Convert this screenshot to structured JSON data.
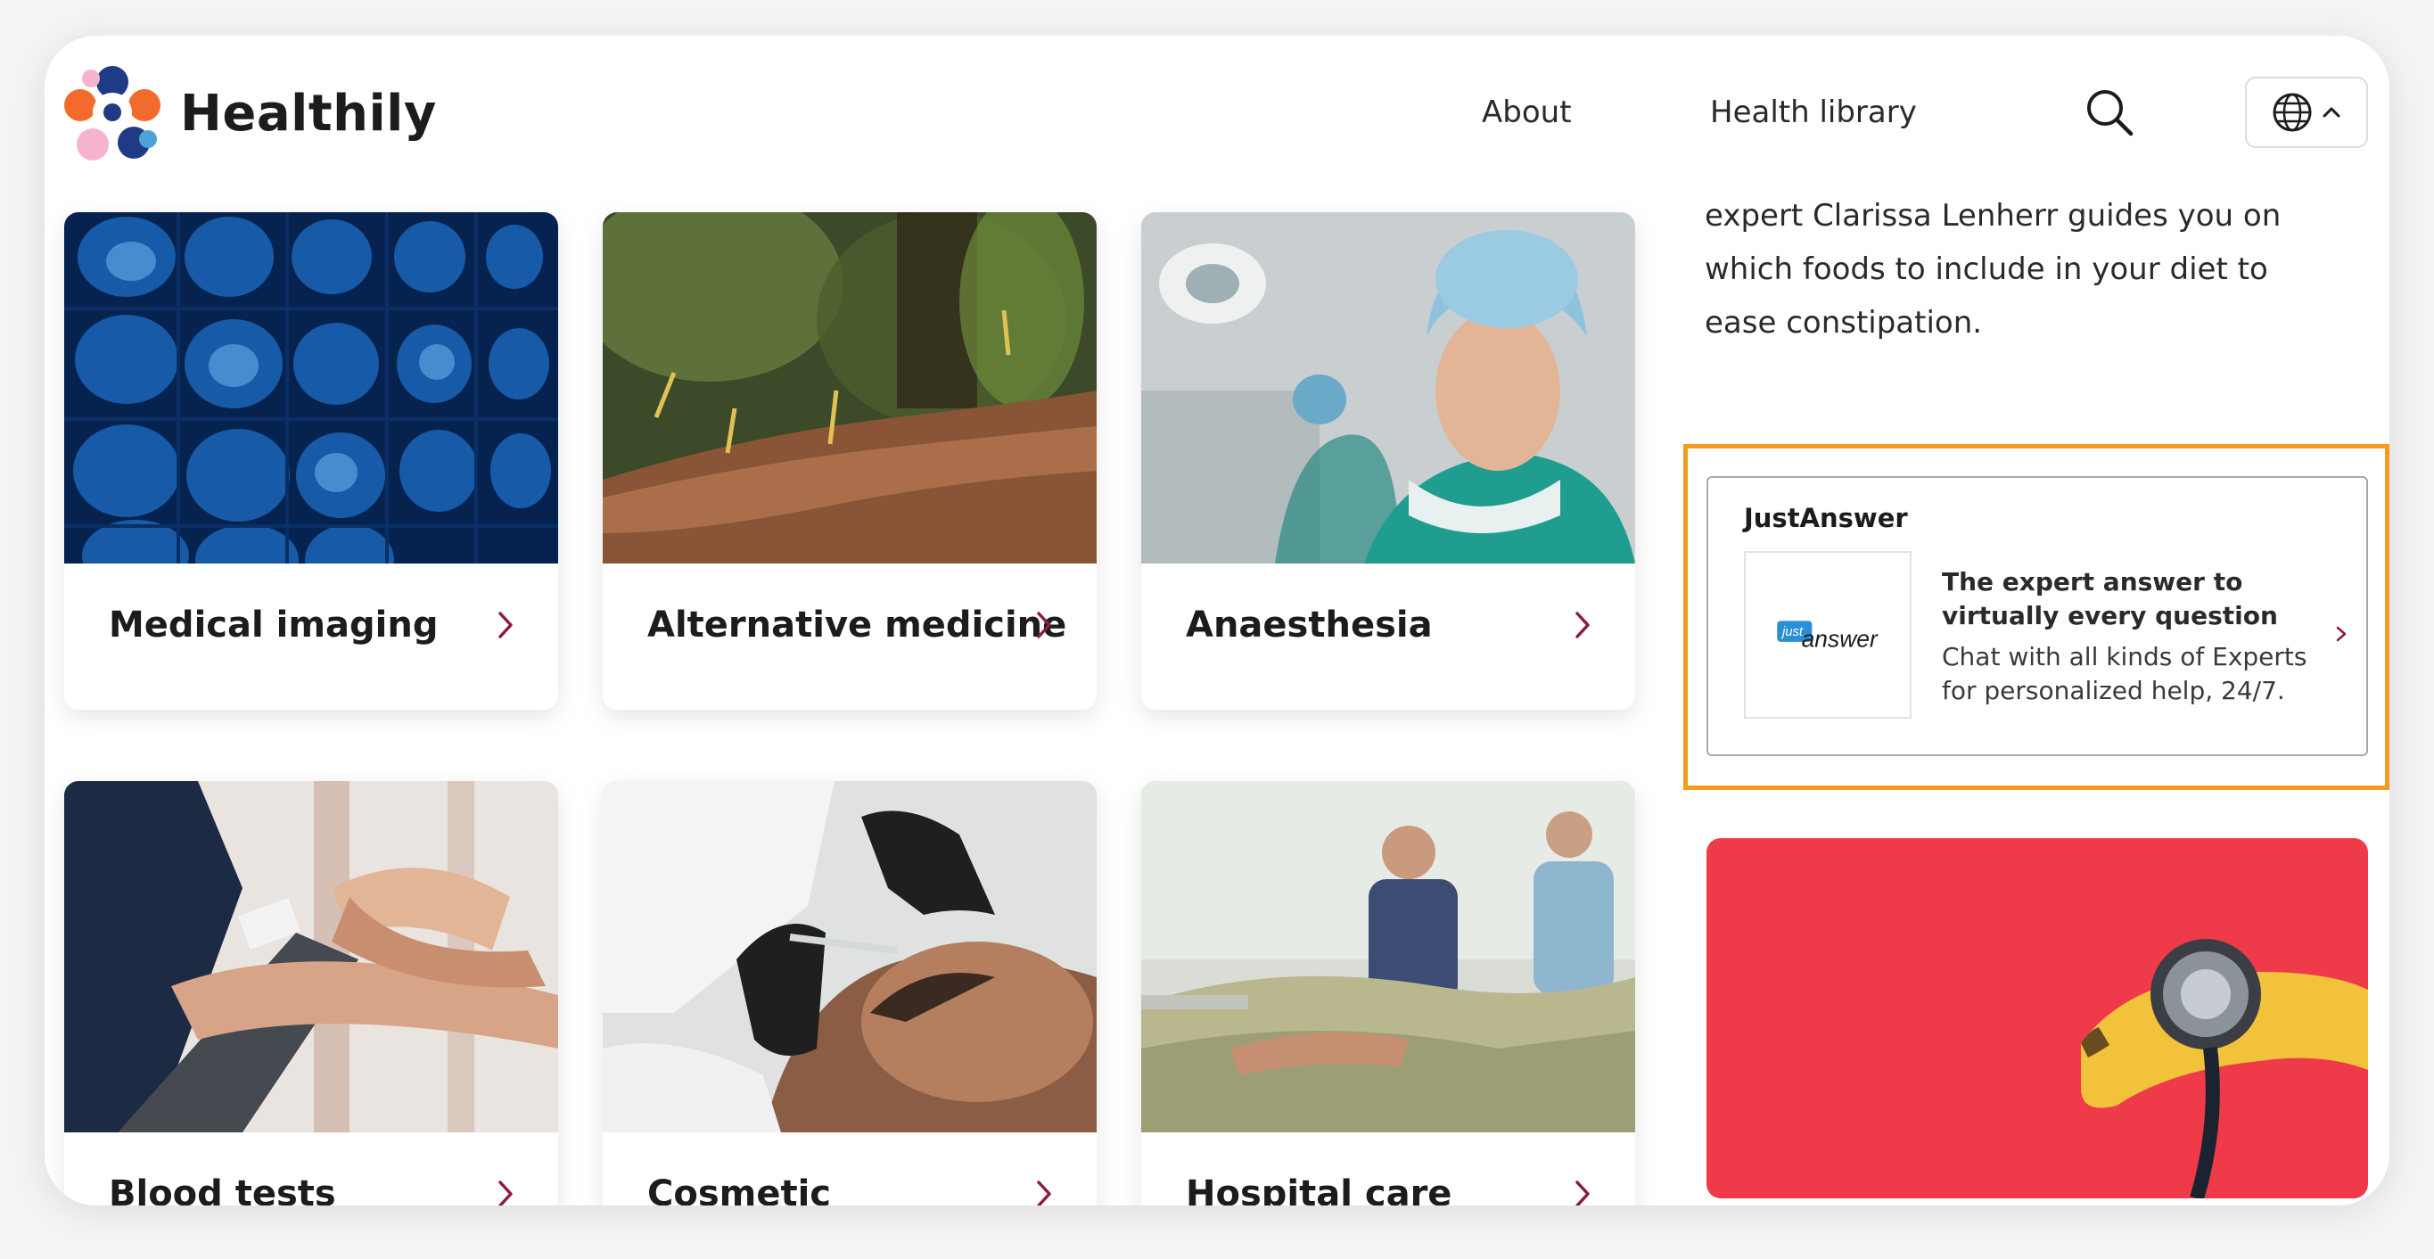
{
  "brand": {
    "name": "Healthily"
  },
  "nav": {
    "about": "About",
    "library": "Health library"
  },
  "icons": {
    "search": "search-icon",
    "globe": "globe-icon",
    "caret": "chevron-up-icon"
  },
  "cards": [
    {
      "label": "Medical imaging"
    },
    {
      "label": "Alternative medicine"
    },
    {
      "label": "Anaesthesia"
    },
    {
      "label": "Blood tests"
    },
    {
      "label": "Cosmetic"
    },
    {
      "label": "Hospital care"
    }
  ],
  "sidebar": {
    "text": "expert Clarissa Lenherr guides you on which foods to include in your diet to ease constipation."
  },
  "ad": {
    "title": "JustAnswer",
    "logo_text": "answer",
    "logo_badge": "just",
    "headline": "The expert answer to virtually every question",
    "description": "Chat with all kinds of Experts for personalized help, 24/7."
  },
  "colors": {
    "accent": "#8b1c3f",
    "highlight": "#f59a1f",
    "promo_bg": "#ef3a4a"
  }
}
